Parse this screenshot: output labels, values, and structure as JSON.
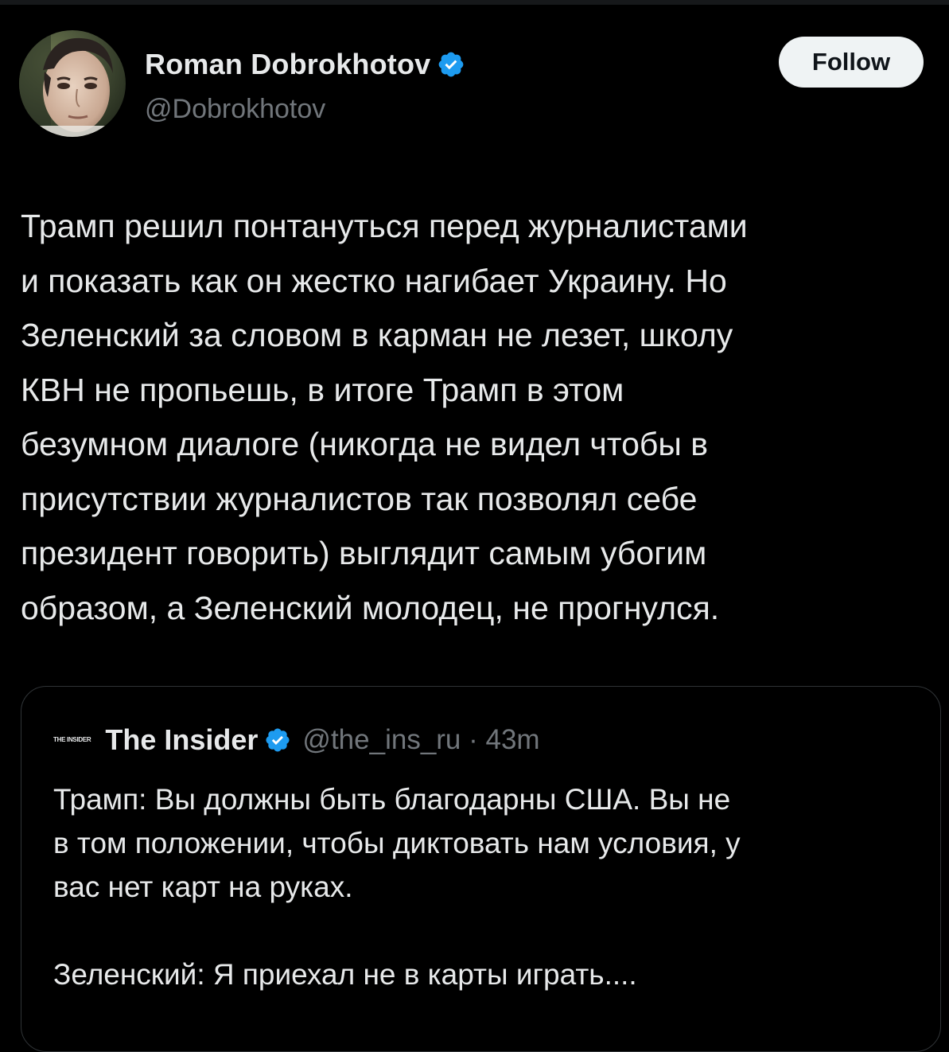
{
  "tweet": {
    "author_name": "Roman Dobrokhotov",
    "author_handle": "@Dobrokhotov",
    "follow_label": "Follow",
    "text": "Трамп решил понтануться перед журналистами\nи показать как он жестко нагибает Украину. Но\nЗеленский   за словом в карман не лезет, школу\nКВН не пропьешь, в итоге Трамп в этом\nбезумном диалоге (никогда не видел чтобы в\nприсутствии журналистов так позволял себе\nпрезидент говорить) выглядит самым убогим\nобразом, а Зеленский молодец, не прогнулся."
  },
  "quote": {
    "logo_text": "THE INSIDER",
    "author_name": "The Insider",
    "handle_time": "@the_ins_ru · 43m",
    "text": "Трамп: Вы должны быть благодарны США. Вы не\nв том положении, чтобы диктовать нам условия, у\nвас нет карт на руках.\n\nЗеленский: Я приехал не в карты играть...."
  },
  "icons": {
    "verified": "verified-badge-icon"
  },
  "colors": {
    "background": "#000000",
    "text_primary": "#e7e9ea",
    "text_secondary": "#71767b",
    "verified_blue": "#1d9bf0",
    "follow_bg": "#eff3f4",
    "border": "#2f3336"
  }
}
